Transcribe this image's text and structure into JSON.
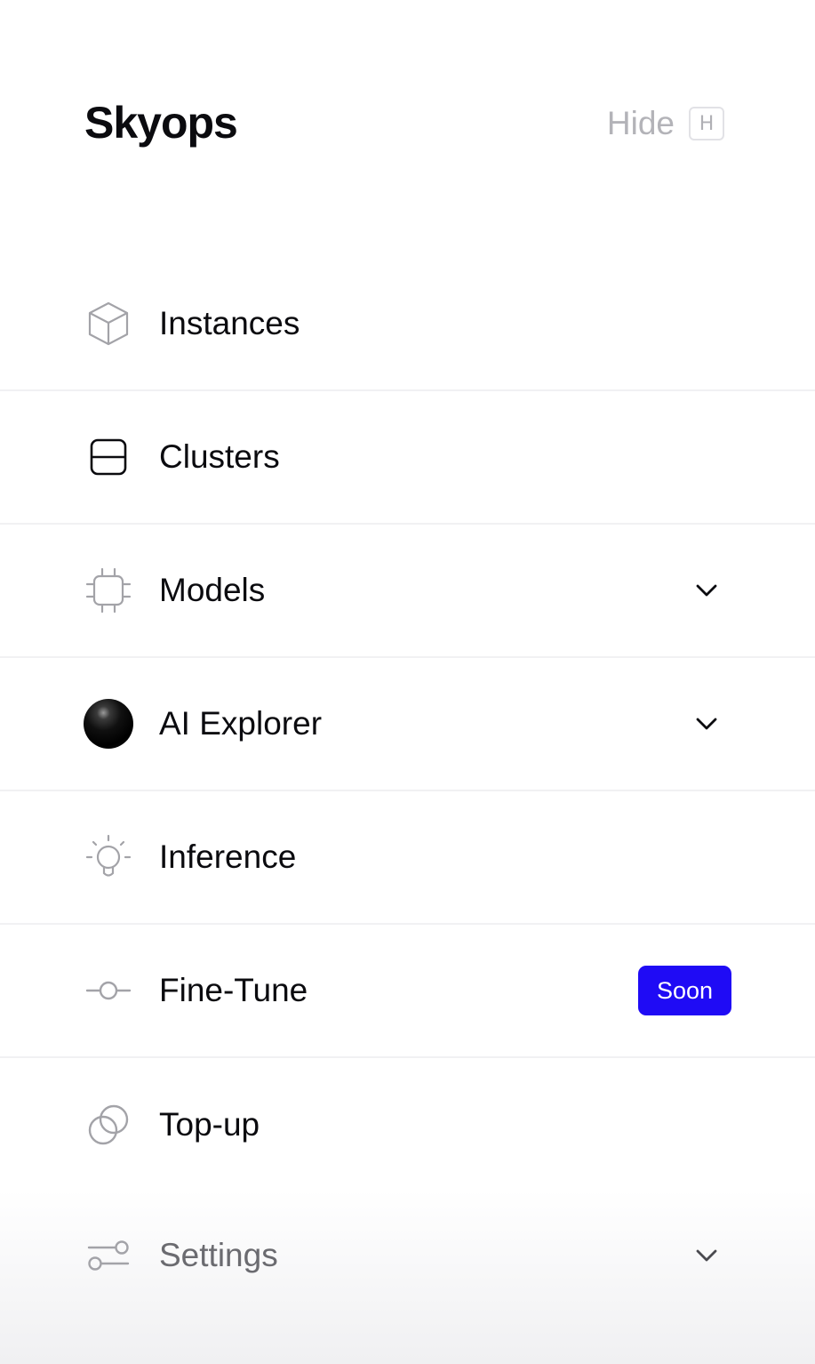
{
  "app": {
    "brand": "Skyops",
    "hide_label": "Hide",
    "hide_shortcut": "H"
  },
  "nav": {
    "items": [
      {
        "label": "Instances",
        "icon": "cube-icon",
        "has_chevron": false
      },
      {
        "label": "Clusters",
        "icon": "server-icon",
        "has_chevron": false
      },
      {
        "label": "Models",
        "icon": "chip-icon",
        "has_chevron": true
      },
      {
        "label": "AI Explorer",
        "icon": "sphere-icon",
        "has_chevron": true
      },
      {
        "label": "Inference",
        "icon": "lightbulb-icon",
        "has_chevron": false
      },
      {
        "label": "Fine-Tune",
        "icon": "commit-icon",
        "has_chevron": false,
        "badge": "Soon"
      },
      {
        "label": "Top-up",
        "icon": "coins-icon",
        "has_chevron": false
      }
    ],
    "settings": {
      "label": "Settings",
      "icon": "sliders-icon",
      "has_chevron": true
    }
  },
  "colors": {
    "accent": "#1f0bf5",
    "text": "#0b0b0f",
    "muted": "#b3b3b8",
    "divider": "#f1f1f3"
  }
}
